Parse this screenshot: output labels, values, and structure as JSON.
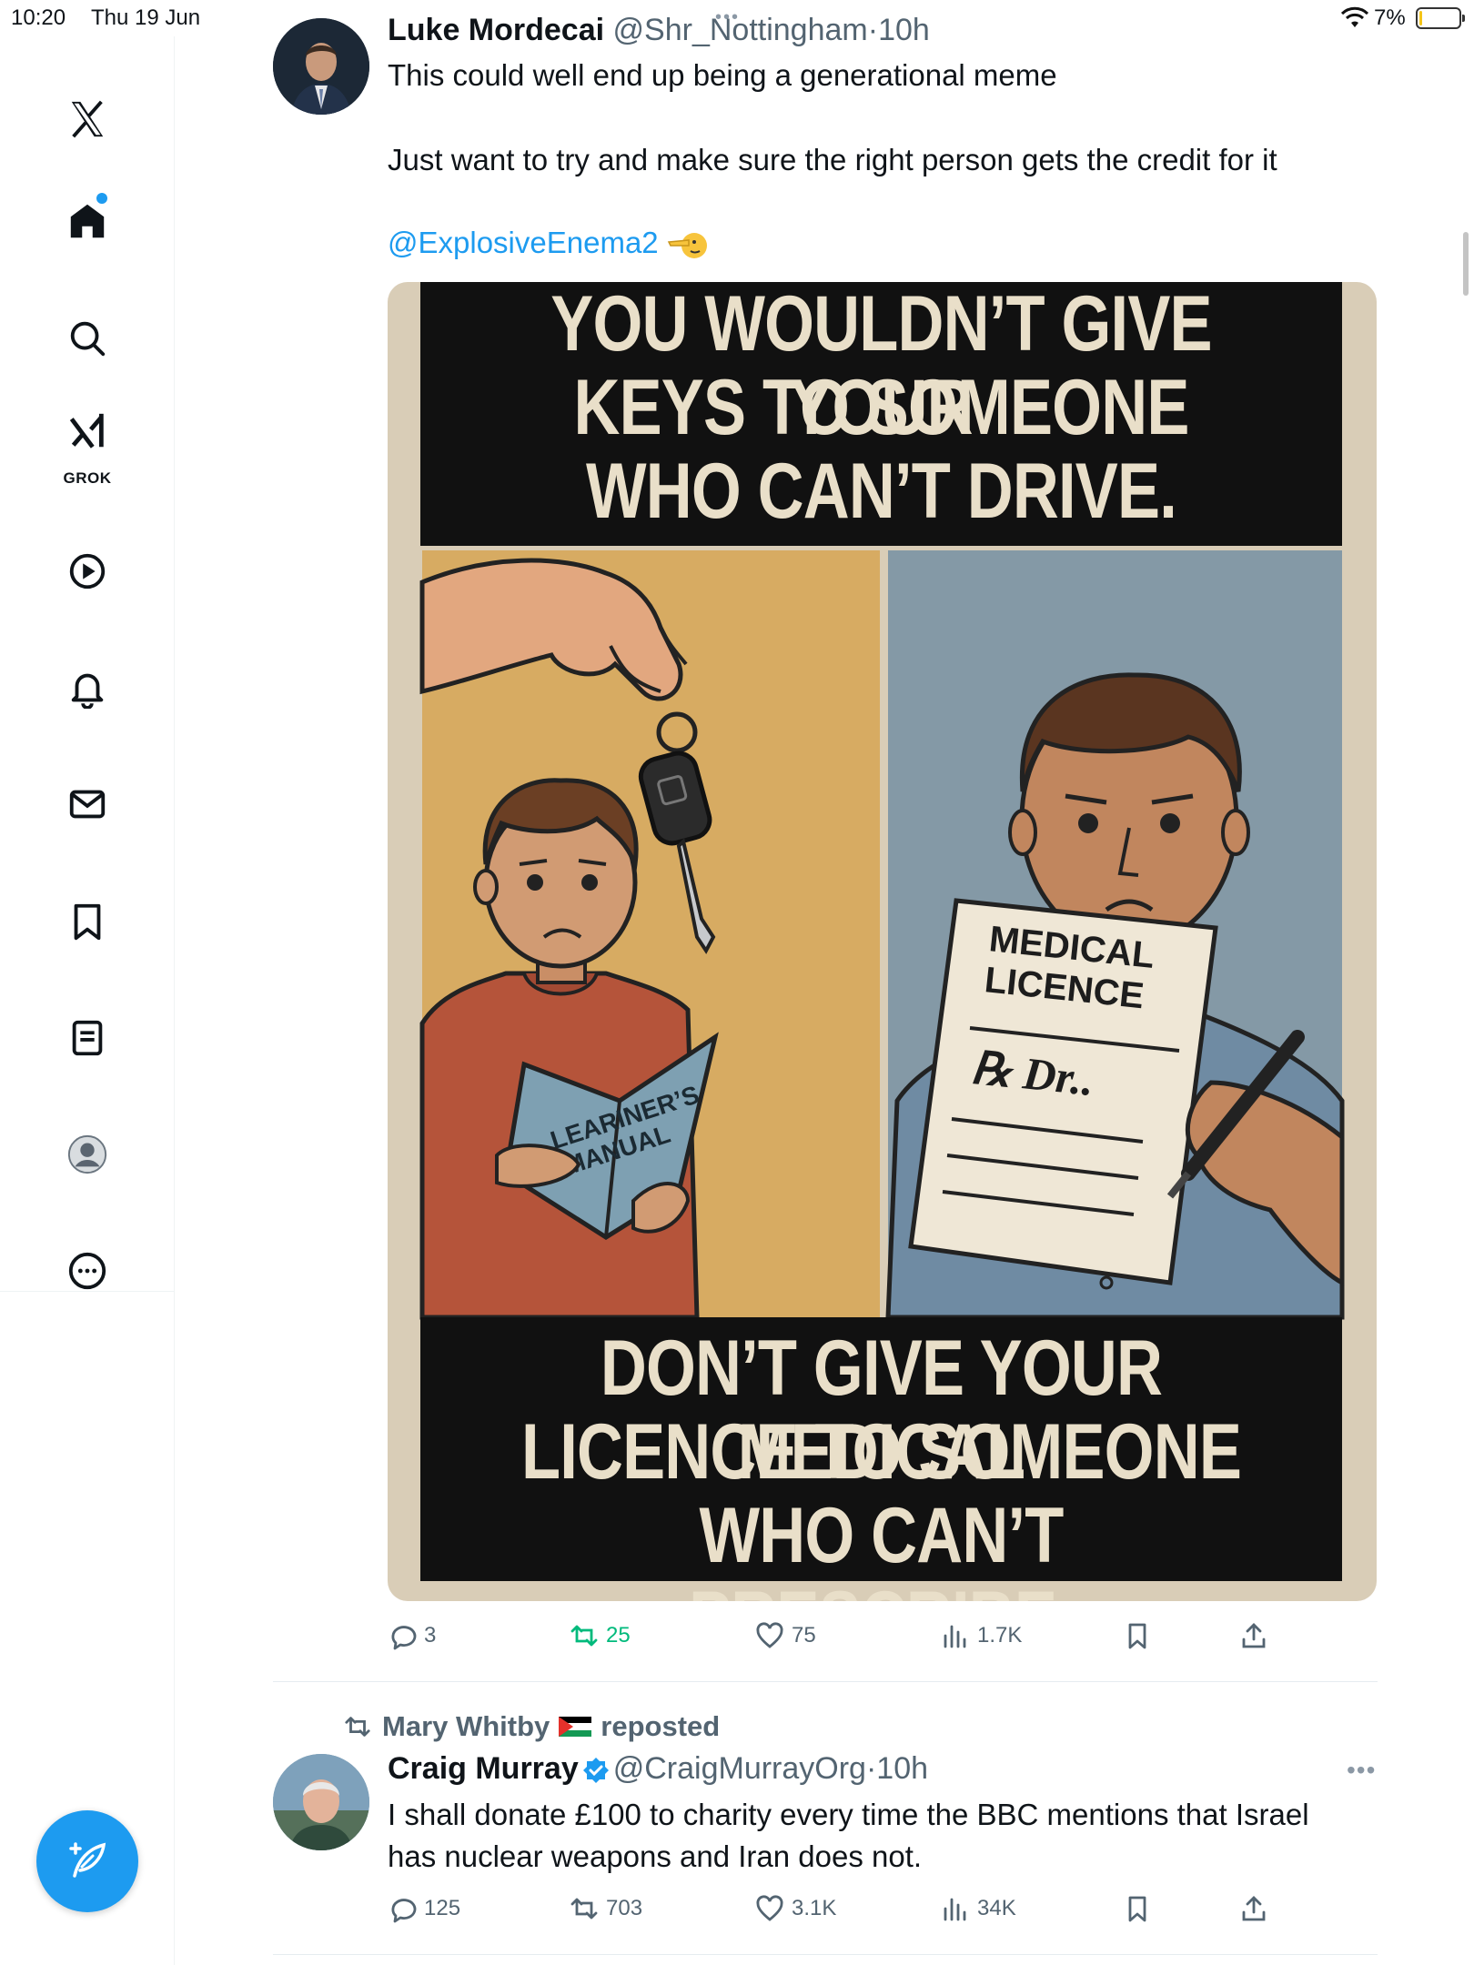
{
  "status_bar": {
    "time": "10:20",
    "date": "Thu 19 Jun",
    "battery_pct": "7%",
    "battery_level": 0.07
  },
  "sidebar": {
    "grok_label": "GROK",
    "items": [
      "x-logo",
      "home",
      "search",
      "grok",
      "videos",
      "notifications",
      "messages",
      "bookmarks",
      "lists",
      "profile",
      "more"
    ]
  },
  "tweet1": {
    "name": "Luke Mordecai",
    "handle": "@Shr_Nottingham",
    "separator": "·",
    "time": "10h",
    "line1": "This could well end up being a generational meme",
    "line2": "Just want to try and make sure the right person gets the credit for it",
    "mention": "@ExplosiveEnema2",
    "meme": {
      "top_text": [
        "YOU WOULDN’T GIVE YOUR",
        "KEYS TO SOMEONE",
        "WHO CAN’T DRIVE."
      ],
      "manual_text": [
        "LEARINER’S",
        "MANUAL"
      ],
      "licence_text": [
        "MEDICAL",
        "LICENCE"
      ],
      "rx_text": "℞ Dr..",
      "bottom_text": [
        "DON’T GIVE YOUR MEDICAL",
        "LICENCE TO SOMEONE",
        "WHO CAN’T PRESCRIBE."
      ]
    },
    "stats": {
      "replies": "3",
      "reposts": "25",
      "likes": "75",
      "views": "1.7K"
    }
  },
  "tweet2": {
    "reposted_by": "Mary Whitby",
    "reposted_label": "reposted",
    "name": "Craig Murray",
    "handle": "@CraigMurrayOrg",
    "separator": "·",
    "time": "10h",
    "text_line1": "I shall donate £100 to charity every time the BBC mentions that Israel",
    "text_line2": "has nuclear weapons and Iran does not.",
    "stats": {
      "replies": "125",
      "reposts": "703",
      "likes": "3.1K",
      "views": "34K"
    }
  },
  "colors": {
    "accent": "#1d9bf0",
    "retweet_green": "#00ba7c",
    "muted": "#536471"
  }
}
